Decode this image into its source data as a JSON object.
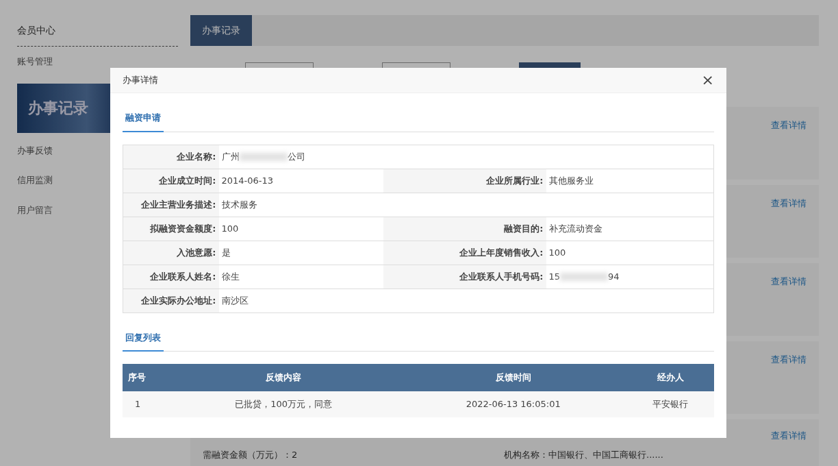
{
  "sidebar": {
    "title": "会员中心",
    "items": [
      {
        "kind": "link",
        "label": "账号管理",
        "selected": false
      },
      {
        "kind": "banner",
        "label": "办事记录",
        "selected": true
      },
      {
        "kind": "link",
        "label": "办事反馈",
        "selected": false
      },
      {
        "kind": "link",
        "label": "信用监测",
        "selected": false
      },
      {
        "kind": "link",
        "label": "用户留言",
        "selected": false
      }
    ]
  },
  "tabs": [
    {
      "label": "办事记录",
      "selected": true
    }
  ],
  "records": [
    {
      "link": "查看详情"
    },
    {
      "link": "查看详情"
    },
    {
      "link": "查看详情"
    },
    {
      "link": "查看详情"
    },
    {
      "link": "查看详情",
      "fields": [
        "需融资金额（万元）：2",
        "机构名称：中国银行、中国工商银行......"
      ]
    }
  ],
  "modal": {
    "title": "办事详情",
    "close": "×",
    "section": "融资申请",
    "details": [
      [
        {
          "label": "企业名称:",
          "value": [
            "广州",
            "公司"
          ],
          "redacted": true
        }
      ],
      [
        {
          "label": "企业成立时间:",
          "value": [
            "2014-06-13"
          ]
        },
        {
          "label": "企业所属行业:",
          "value": [
            "其他服务业"
          ]
        }
      ],
      [
        {
          "label": "企业主营业务描述:",
          "value": [
            "技术服务"
          ]
        }
      ],
      [
        {
          "label": "拟融资资金额度:",
          "value": [
            "100"
          ]
        },
        {
          "label": "融资目的:",
          "value": [
            "补充流动资金"
          ]
        }
      ],
      [
        {
          "label": "入池意愿:",
          "value": [
            "是"
          ]
        },
        {
          "label": "企业上年度销售收入:",
          "value": [
            "100"
          ]
        }
      ],
      [
        {
          "label": "企业联系人姓名:",
          "value": [
            "徐生"
          ]
        },
        {
          "label": "企业联系人手机号码:",
          "value": [
            "15",
            "94"
          ],
          "redacted": true
        }
      ],
      [
        {
          "label": "企业实际办公地址:",
          "value": [
            "南沙区"
          ]
        }
      ]
    ],
    "replies_title": "回复列表",
    "reply_columns": [
      "序号",
      "反馈内容",
      "反馈时间",
      "经办人"
    ],
    "reply_rows": [
      [
        "1",
        "已批贷，100万元，同意",
        "2022-06-13 16:05:01",
        "平安银行"
      ]
    ]
  }
}
